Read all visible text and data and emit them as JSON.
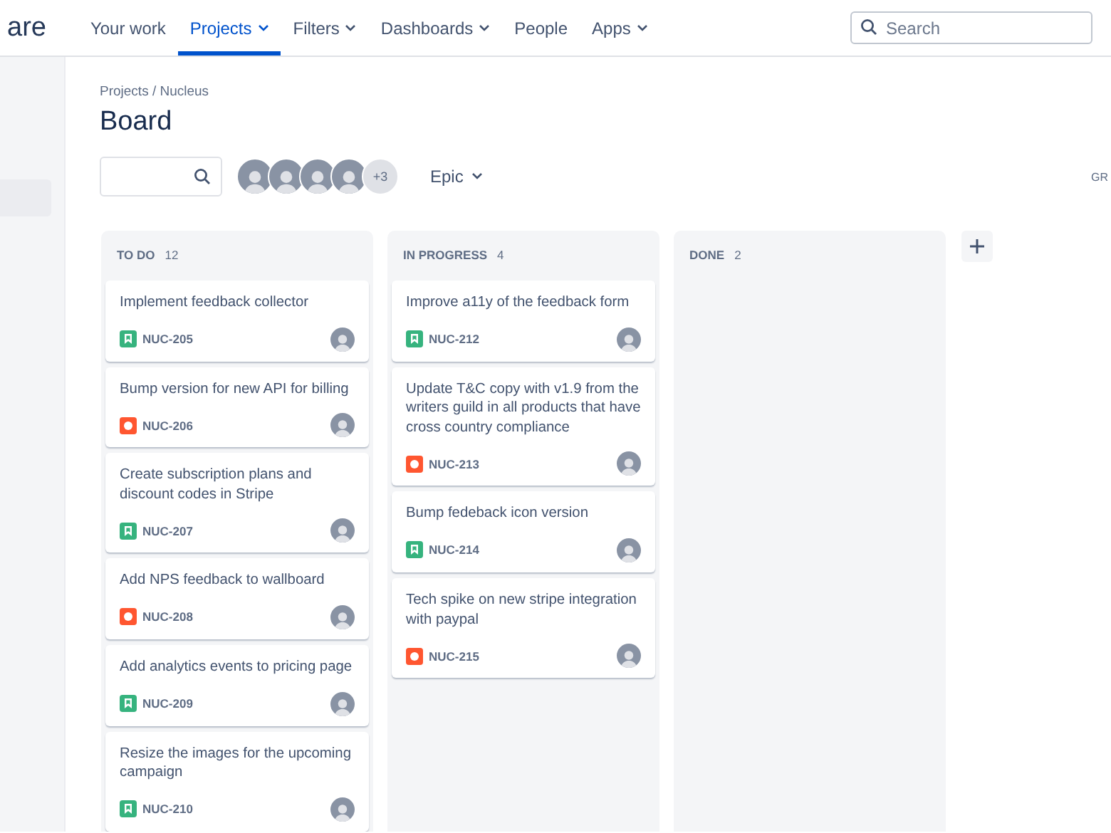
{
  "logo": {
    "text": "are"
  },
  "nav": [
    {
      "label": "Your work",
      "dropdown": false,
      "selected": false
    },
    {
      "label": "Projects",
      "dropdown": true,
      "selected": true
    },
    {
      "label": "Filters",
      "dropdown": true,
      "selected": false
    },
    {
      "label": "Dashboards",
      "dropdown": true,
      "selected": false
    },
    {
      "label": "People",
      "dropdown": false,
      "selected": false
    },
    {
      "label": "Apps",
      "dropdown": true,
      "selected": false
    }
  ],
  "search": {
    "placeholder": "Search"
  },
  "breadcrumb": "Projects / Nucleus",
  "title": "Board",
  "toolbar": {
    "more_people": "+3",
    "filter": "Epic",
    "group_label": "GR"
  },
  "columns": [
    {
      "name": "TO DO",
      "count": "12",
      "cards": [
        {
          "title": "Implement feedback collector",
          "kind": "story",
          "key": "NUC-205"
        },
        {
          "title": "Bump version for new API for billing",
          "kind": "bug",
          "key": "NUC-206"
        },
        {
          "title": "Create subscription plans and discount codes in Stripe",
          "kind": "story",
          "key": "NUC-207"
        },
        {
          "title": "Add NPS feedback to wallboard",
          "kind": "bug",
          "key": "NUC-208"
        },
        {
          "title": "Add analytics events to pricing page",
          "kind": "story",
          "key": "NUC-209"
        },
        {
          "title": "Resize the images for the upcoming campaign",
          "kind": "story",
          "key": "NUC-210"
        }
      ]
    },
    {
      "name": "IN PROGRESS",
      "count": "4",
      "cards": [
        {
          "title": "Improve a11y of the feedback form",
          "kind": "story",
          "key": "NUC-212"
        },
        {
          "title": "Update T&C copy with v1.9 from the writers guild in all products that have cross country compliance",
          "kind": "bug",
          "key": "NUC-213"
        },
        {
          "title": "Bump fedeback icon version",
          "kind": "story",
          "key": "NUC-214"
        },
        {
          "title": "Tech spike on new stripe integration with paypal",
          "kind": "bug",
          "key": "NUC-215"
        }
      ]
    },
    {
      "name": "DONE",
      "count": "2"
    }
  ]
}
